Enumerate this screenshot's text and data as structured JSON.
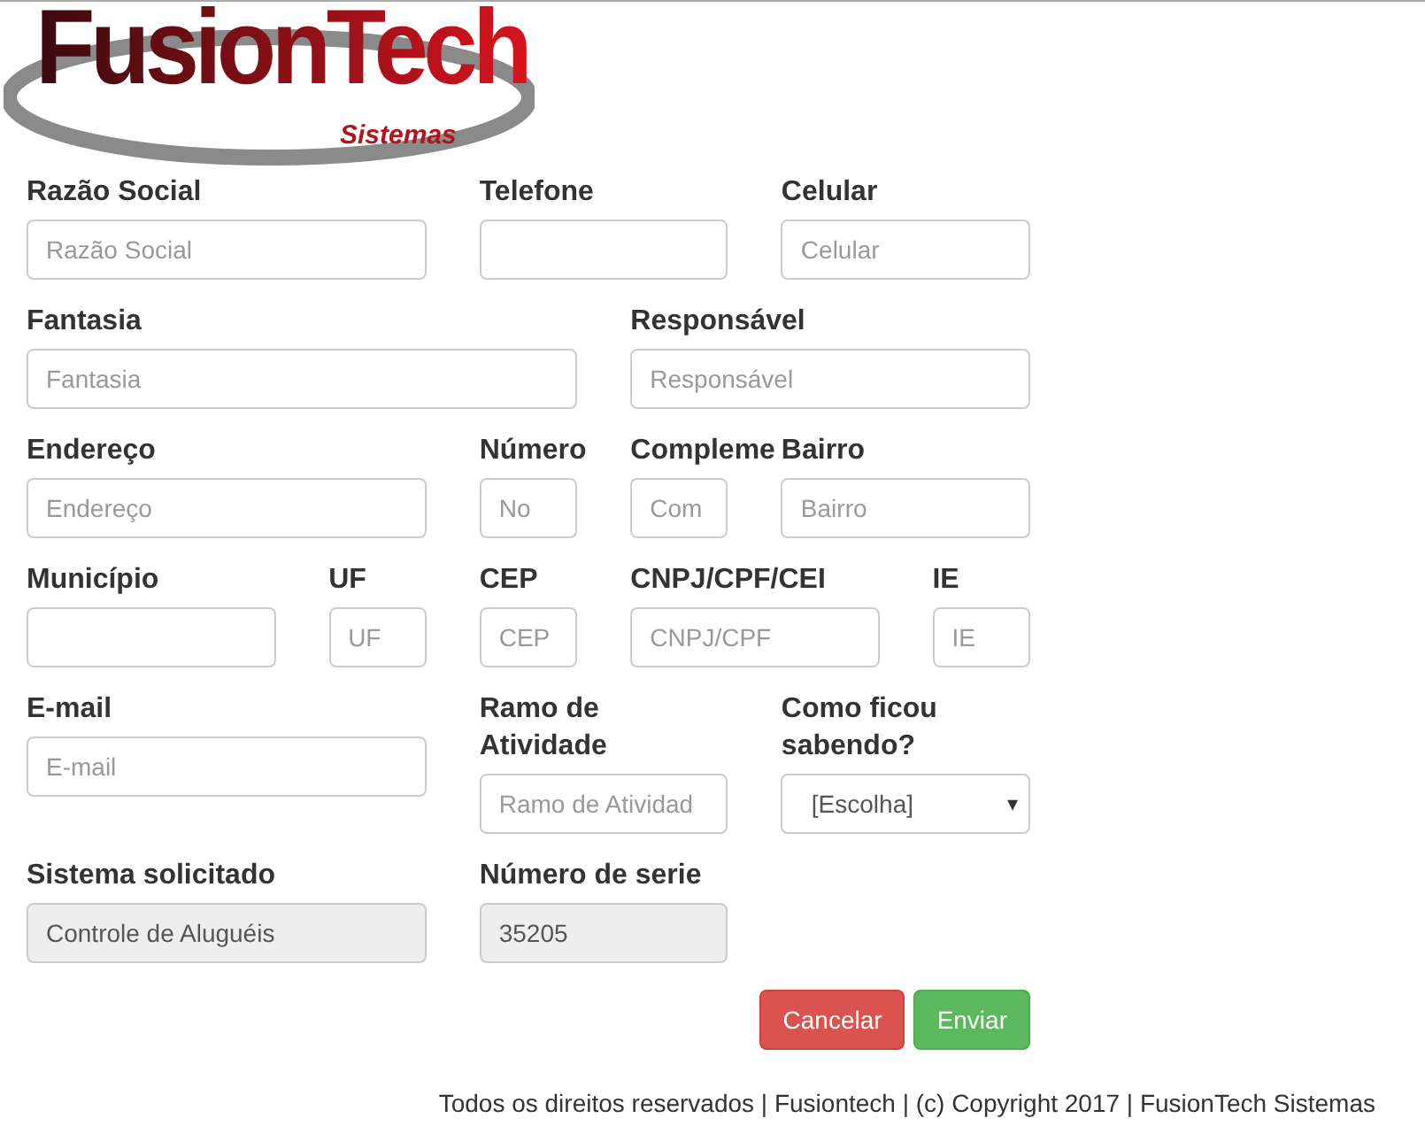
{
  "logo": {
    "name": "FusionTech",
    "subtitle": "Sistemas"
  },
  "form": {
    "rows": [
      {
        "fields": [
          {
            "kind": "input",
            "label": "Razão Social",
            "placeholder": "Razão Social"
          },
          {
            "kind": "input",
            "label": "Telefone"
          },
          {
            "kind": "input",
            "label": "Celular",
            "placeholder": "Celular"
          }
        ]
      },
      {
        "fields": [
          {
            "kind": "input",
            "label": "Fantasia",
            "placeholder": "Fantasia"
          },
          {
            "kind": "input",
            "label": "Responsável",
            "placeholder": "Responsável"
          }
        ]
      },
      {
        "fields": [
          {
            "kind": "input",
            "label": "Endereço",
            "placeholder": "Endereço"
          },
          {
            "kind": "input",
            "label": "Número",
            "placeholder": "No"
          },
          {
            "kind": "input",
            "label": "Compleme",
            "placeholder": "Com"
          },
          {
            "kind": "input",
            "label": "Bairro",
            "placeholder": "Bairro"
          }
        ]
      },
      {
        "fields": [
          {
            "kind": "input",
            "label": "Município"
          },
          {
            "kind": "input",
            "label": "UF",
            "placeholder": "UF"
          },
          {
            "kind": "input",
            "label": "CEP",
            "placeholder": "CEP"
          },
          {
            "kind": "input",
            "label": "CNPJ/CPF/CEI",
            "placeholder": "CNPJ/CPF"
          },
          {
            "kind": "input",
            "label": "IE",
            "placeholder": "IE"
          }
        ]
      },
      {
        "fields": [
          {
            "kind": "input",
            "label": "E-mail",
            "placeholder": "E-mail"
          },
          {
            "kind": "input",
            "label": "Ramo de Atividade",
            "placeholder": "Ramo de Atividad"
          },
          {
            "kind": "select",
            "label": "Como ficou sabendo?",
            "value": "[Escolha]",
            "icon": "▾"
          }
        ]
      },
      {
        "fields": [
          {
            "kind": "input",
            "label": "Sistema solicitado",
            "value": "Controle de Aluguéis",
            "disabled": true
          },
          {
            "kind": "input",
            "label": "Número de serie",
            "value": "35205",
            "disabled": true
          }
        ]
      }
    ],
    "buttons": [
      {
        "kind": "danger",
        "label": "Cancelar"
      },
      {
        "kind": "success",
        "label": "Enviar"
      }
    ]
  },
  "footer": "Todos os direitos reservados | Fusiontech | (c) Copyright 2017 | FusionTech Sistemas"
}
